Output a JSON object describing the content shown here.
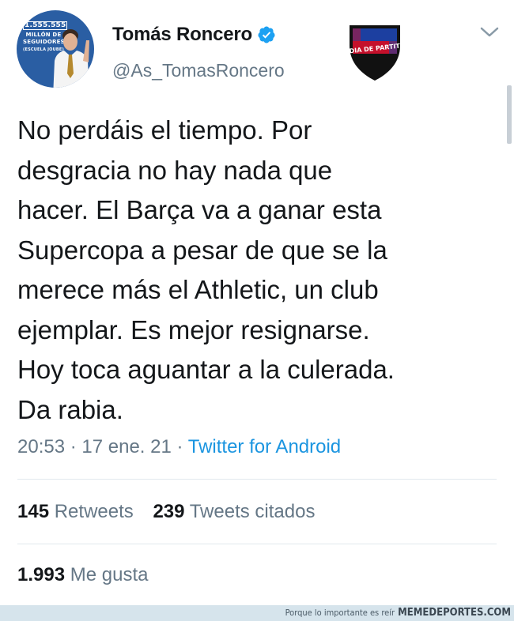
{
  "tweet": {
    "author": {
      "name": "Tomás Roncero",
      "handle": "@As_TomasRoncero",
      "verified": true,
      "avatar_icon": "profile-photo",
      "avatar_text": {
        "number": "1.555.555",
        "line1": "MILLÓN DE",
        "line2": "SEGUIDORES",
        "line3": "(ESCUELA JOUBE)"
      },
      "badge": {
        "icon": "shield-crest-icon",
        "text": "DIA DE PARTIT",
        "colors": [
          "#1c3fa0",
          "#c4102b",
          "#111111"
        ]
      }
    },
    "text": "No perdáis el tiempo. Por desgracia no hay nada que hacer. El Barça va a ganar esta Supercopa a pesar de que se la merece más el Athletic, un club ejemplar. Es mejor resignarse. Hoy toca aguantar a la culerada. Da rabia.",
    "lines": [
      "No perdáis el tiempo. Por",
      "desgracia no hay nada que",
      "hacer. El Barça va a ganar esta",
      "Supercopa a pesar de que se la",
      "merece más el Athletic, un club",
      "ejemplar. Es mejor resignarse.",
      "Hoy toca aguantar a la culerada.",
      "Da rabia."
    ],
    "meta": {
      "time": "20:53",
      "separator": " · ",
      "date": "17 ene. 21",
      "source": "Twitter for Android"
    },
    "stats": {
      "retweets_count": "145",
      "retweets_label": "Retweets",
      "quotes_count": "239",
      "quotes_label": "Tweets citados",
      "likes_count": "1.993",
      "likes_label": "Me gusta"
    },
    "menu_icon": "chevron-down-icon"
  },
  "footer": {
    "tagline": "Porque lo importante es reír",
    "site": "MEMEDEPORTES.COM"
  },
  "colors": {
    "link": "#1b95e0",
    "secondary_text": "#657786",
    "primary_text": "#14171a",
    "verified": "#1da1f2",
    "divider": "#e1e8ed",
    "avatar_bg": "#2a5ea3"
  }
}
